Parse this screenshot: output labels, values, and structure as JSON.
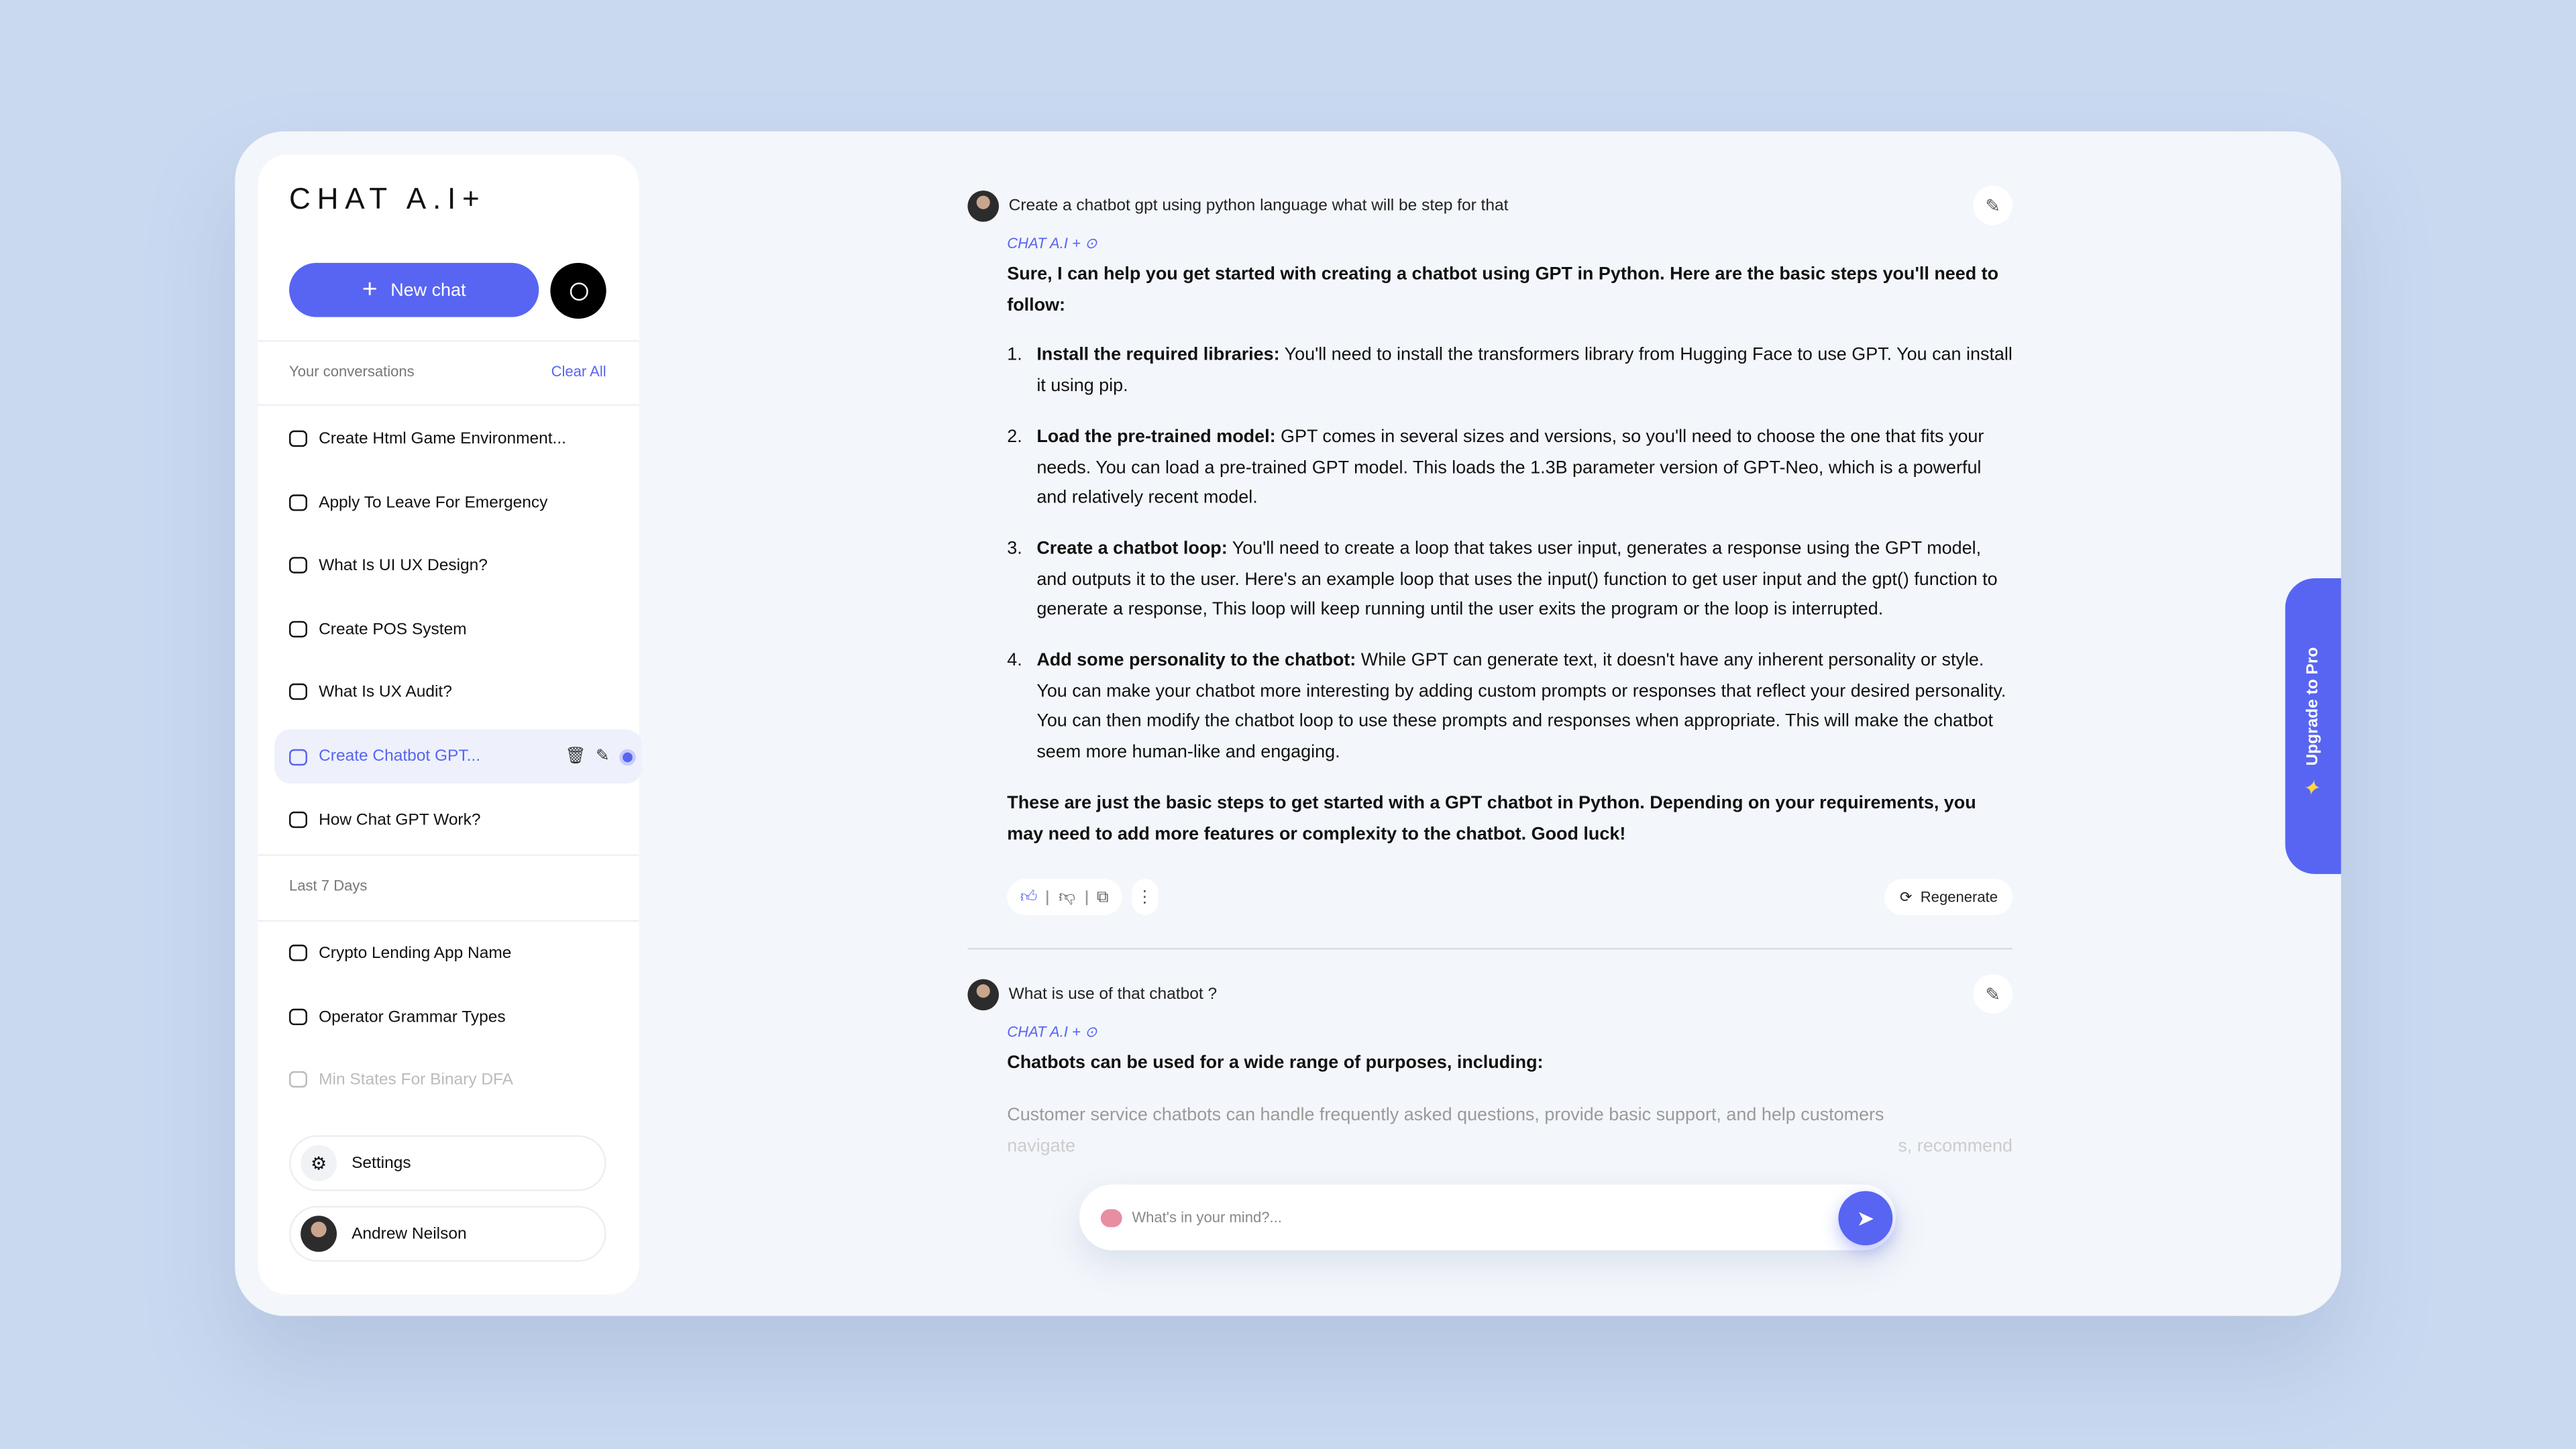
{
  "app": {
    "logo": "CHAT A.I+",
    "accent": "#5865f2"
  },
  "sidebar": {
    "new_chat": "New chat",
    "conversations_label": "Your conversations",
    "clear_all": "Clear All",
    "items": [
      {
        "label": "Create Html Game Environment..."
      },
      {
        "label": "Apply To Leave For Emergency"
      },
      {
        "label": "What Is UI UX Design?"
      },
      {
        "label": "Create POS System"
      },
      {
        "label": "What Is UX Audit?"
      },
      {
        "label": "Create Chatbot GPT...",
        "active": true
      },
      {
        "label": "How Chat GPT Work?"
      }
    ],
    "last7_label": "Last 7 Days",
    "last7_items": [
      {
        "label": "Crypto Lending App Name"
      },
      {
        "label": "Operator Grammar Types"
      },
      {
        "label": "Min States For Binary DFA"
      }
    ],
    "settings": "Settings",
    "user": "Andrew Neilson"
  },
  "chat": {
    "q1": "Create a chatbot gpt using python language what will be step for that",
    "brand": "CHAT A.I +",
    "a1_intro": "Sure, I can help you get started with creating a chatbot using GPT in Python. Here are the basic steps you'll need to follow:",
    "steps": [
      {
        "n": "1.",
        "title": "Install the required libraries:",
        "text": " You'll need to install the transformers library from Hugging Face to use GPT. You can install it using pip."
      },
      {
        "n": "2.",
        "title": "Load the pre-trained model:",
        "text": " GPT comes in several sizes and versions, so you'll need to choose the one that fits your needs. You can load a pre-trained GPT model. This loads the 1.3B parameter version of GPT-Neo, which is a powerful and relatively recent model."
      },
      {
        "n": "3.",
        "title": "Create a chatbot loop:",
        "text": " You'll need to create a loop that takes user input, generates a response using the GPT model, and outputs it to the user. Here's an example loop that uses the input() function to get user input and the gpt() function to generate a response, This loop will keep running until the user exits the program or the loop is interrupted."
      },
      {
        "n": "4.",
        "title": "Add some personality to the chatbot:",
        "text": " While GPT can generate text, it doesn't have any inherent personality or style. You can make your chatbot more interesting by adding custom prompts or responses that reflect your desired personality. You can then modify the chatbot loop to use these prompts and responses when appropriate. This will make the chatbot seem more human-like and engaging."
      }
    ],
    "a1_outro": "These are just the basic steps to get started with a GPT chatbot in Python. Depending on your requirements, you may need to add more features or complexity to the chatbot. Good luck!",
    "regenerate": "Regenerate",
    "q2": "What is use of that chatbot ?",
    "a2_intro": "Chatbots can be used for a wide range of purposes, including:",
    "a2_line1": "Customer service chatbots can handle frequently asked questions, provide basic support, and help customers",
    "a2_line2_left": "navigate",
    "a2_line2_right": "s, recommend"
  },
  "input": {
    "placeholder": "What's in your mind?..."
  },
  "upgrade": "Upgrade to Pro"
}
